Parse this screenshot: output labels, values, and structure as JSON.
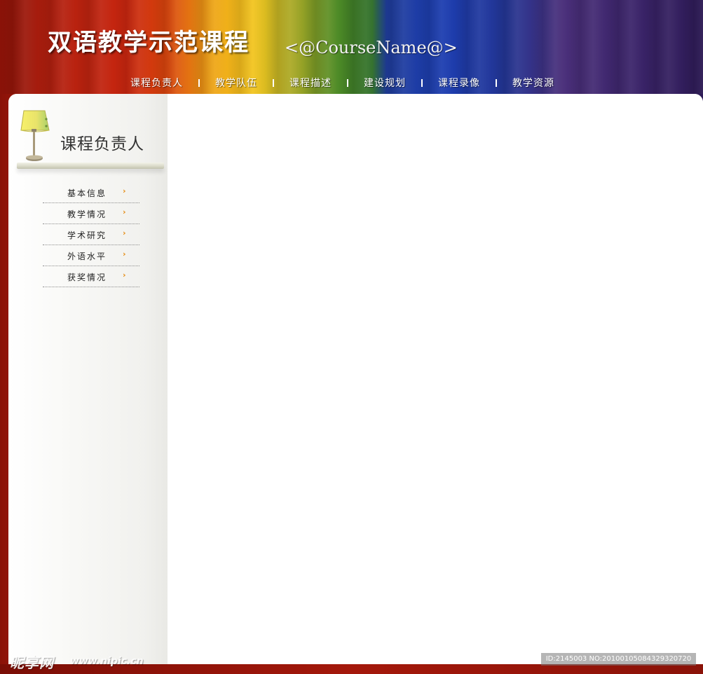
{
  "header": {
    "site_title": "双语教学示范课程",
    "course_name": "<@CourseName@>",
    "nav": [
      {
        "label": "课程负责人"
      },
      {
        "label": "教学队伍"
      },
      {
        "label": "课程描述"
      },
      {
        "label": "建设规划"
      },
      {
        "label": "课程录像"
      },
      {
        "label": "教学资源"
      }
    ]
  },
  "sidebar": {
    "icon": "lamp-icon",
    "section_title": "课程负责人",
    "items": [
      {
        "label": "基本信息",
        "icon": "chevron-right-icon",
        "glyph": "›"
      },
      {
        "label": "教学情况",
        "icon": "chevron-right-icon",
        "glyph": "›"
      },
      {
        "label": "学术研究",
        "icon": "chevron-right-icon",
        "glyph": "›"
      },
      {
        "label": "外语水平",
        "icon": "chevron-right-icon",
        "glyph": "›"
      },
      {
        "label": "获奖情况",
        "icon": "chevron-right-icon",
        "glyph": "›"
      }
    ]
  },
  "watermark": {
    "logo": "昵享网",
    "url": "www.nipic.cn",
    "id": "ID:2145003 NO:20100105084329320720"
  },
  "colors": {
    "accent_chevron": "#e58a10",
    "panel_bg": "#ffffff",
    "footer_red": "#a4180b"
  }
}
